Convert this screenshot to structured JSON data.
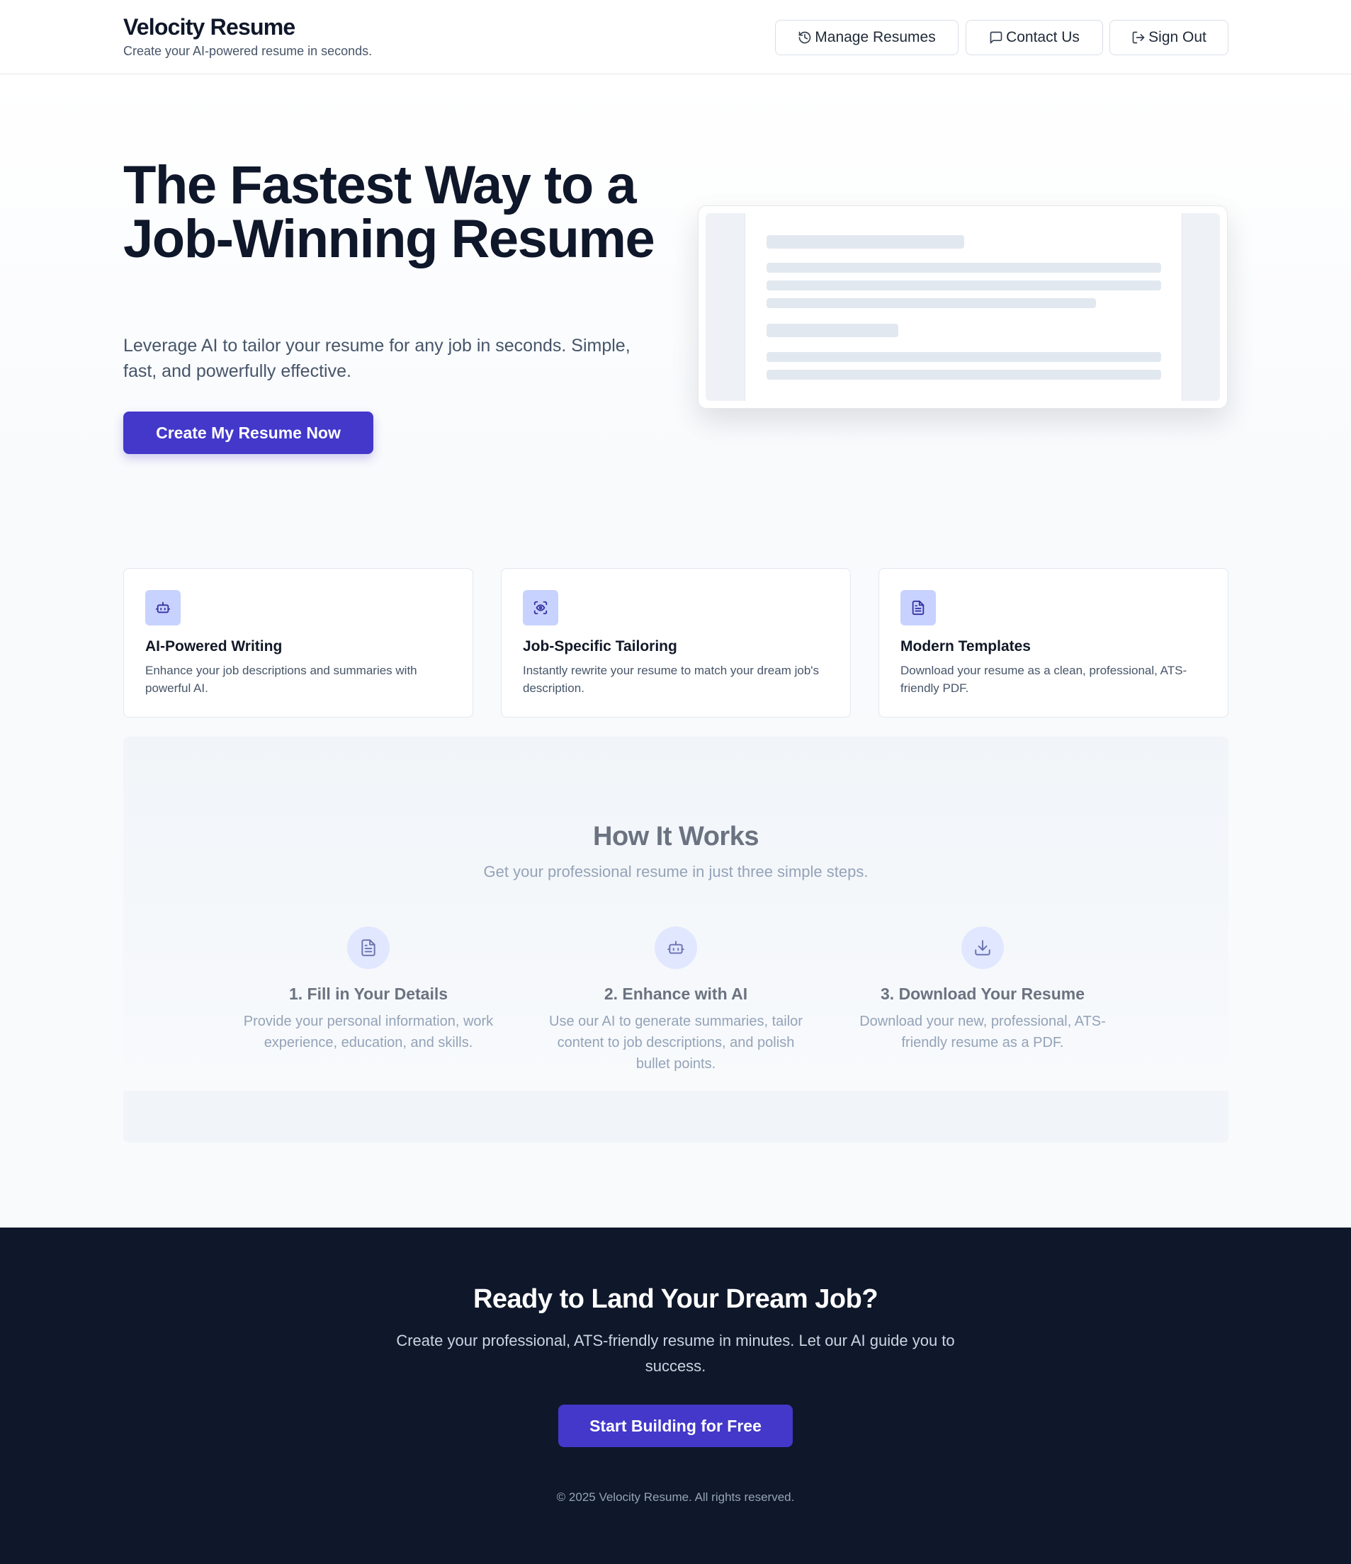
{
  "header": {
    "brand": "Velocity Resume",
    "tagline": "Create your AI-powered resume in seconds.",
    "nav": [
      {
        "label": "Manage Resumes",
        "icon": "history-icon"
      },
      {
        "label": "Contact Us",
        "icon": "message-icon"
      },
      {
        "label": "Sign Out",
        "icon": "sign-out-icon"
      }
    ]
  },
  "hero": {
    "title": "The Fastest Way to a Job-Winning Resume",
    "subtitle": "Leverage AI to tailor your resume for any job in seconds. Simple, fast, and powerfully effective.",
    "cta": "Create My Resume Now"
  },
  "features": [
    {
      "title": "AI-Powered Writing",
      "description": "Enhance your job descriptions and summaries with powerful AI.",
      "icon": "robot-icon"
    },
    {
      "title": "Job-Specific Tailoring",
      "description": "Instantly rewrite your resume to match your dream job's description.",
      "icon": "scan-eye-icon"
    },
    {
      "title": "Modern Templates",
      "description": "Download your resume as a clean, professional, ATS-friendly PDF.",
      "icon": "document-icon"
    }
  ],
  "how_it_works": {
    "title": "How It Works",
    "subtitle": "Get your professional resume in just three simple steps.",
    "steps": [
      {
        "title": "1. Fill in Your Details",
        "description": "Provide your personal information, work experience, education, and skills.",
        "icon": "document-icon"
      },
      {
        "title": "2. Enhance with AI",
        "description": "Use our AI to generate summaries, tailor content to job descriptions, and polish bullet points.",
        "icon": "robot-icon"
      },
      {
        "title": "3. Download Your Resume",
        "description": "Download your new, professional, ATS-friendly resume as a PDF.",
        "icon": "download-icon"
      }
    ]
  },
  "footer": {
    "title": "Ready to Land Your Dream Job?",
    "subtitle": "Create your professional, ATS-friendly resume in minutes. Let our AI guide you to success.",
    "cta": "Start Building for Free",
    "copyright": "© 2025 Velocity Resume. All rights reserved."
  },
  "colors": {
    "accent": "#4338ca",
    "dark": "#0f172a",
    "icon_bg": "#c7d2fe"
  }
}
